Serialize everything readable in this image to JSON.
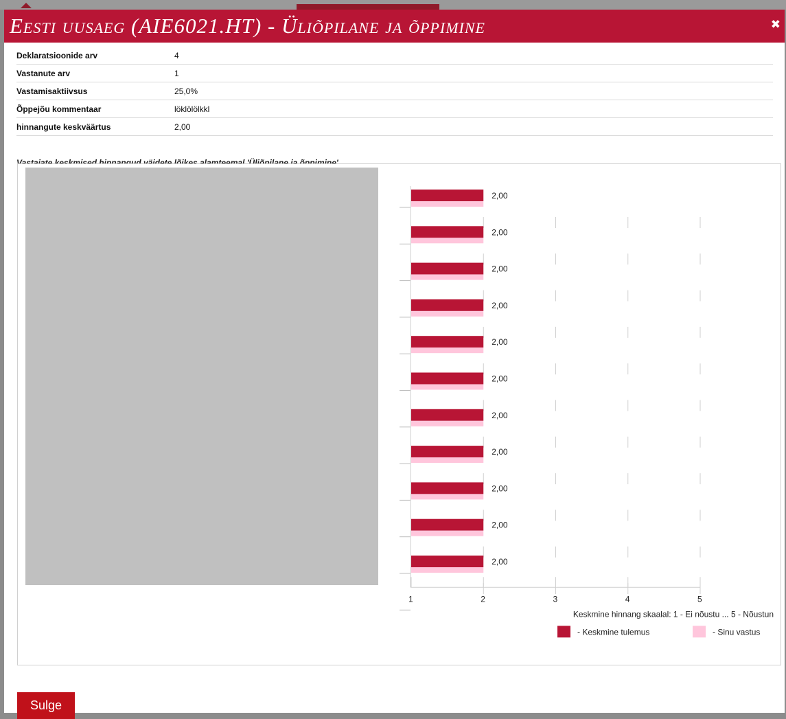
{
  "dialog": {
    "title": "Eesti uusaeg (AIE6021.HT) - Üliõpilane ja õppimine",
    "close_icon": "close-icon",
    "close_button_label": "Sulge"
  },
  "stats": [
    {
      "label": "Deklaratsioonide arv",
      "value": "4"
    },
    {
      "label": "Vastanute arv",
      "value": "1"
    },
    {
      "label": "Vastamisaktiivsus",
      "value": "25,0%"
    },
    {
      "label": "Õppejõu kommentaar",
      "value": "löklölölkkl"
    },
    {
      "label": "hinnangute keskväärtus",
      "value": "2,00"
    }
  ],
  "chart_subtitle": "Vastajate keskmised hinnangud väidete lõikes alamteemal 'Üliõpilane ja õppimine'",
  "colors": {
    "brand": "#b81535",
    "average_bar": "#b81535",
    "your_answer_bar": "#ffc6dc",
    "button": "#c0111a"
  },
  "chart_data": {
    "type": "bar",
    "orientation": "horizontal",
    "categories": [
      "",
      "",
      "",
      "",
      "",
      "",
      "",
      "",
      "",
      "",
      ""
    ],
    "series": [
      {
        "name": "Keskmine tulemus",
        "values": [
          2,
          2,
          2,
          2,
          2,
          2,
          2,
          2,
          2,
          2,
          2
        ]
      },
      {
        "name": "Sinu vastus",
        "values": [
          2,
          2,
          2,
          2,
          2,
          2,
          2,
          2,
          2,
          2,
          2
        ]
      }
    ],
    "data_labels": [
      "2,00",
      "2,00",
      "2,00",
      "2,00",
      "2,00",
      "2,00",
      "2,00",
      "2,00",
      "2,00",
      "2,00",
      "2,00"
    ],
    "xlim": [
      1,
      5
    ],
    "xticks": [
      "1",
      "2",
      "3",
      "4",
      "5"
    ],
    "xlabel": "Keskmine hinnang skaalal: 1 - Ei nõustu ... 5 - Nõustun",
    "legend": [
      {
        "label": "- Keskmine tulemus"
      },
      {
        "label": "- Sinu vastus"
      }
    ],
    "legend_position": "bottom-right",
    "grid": true
  }
}
